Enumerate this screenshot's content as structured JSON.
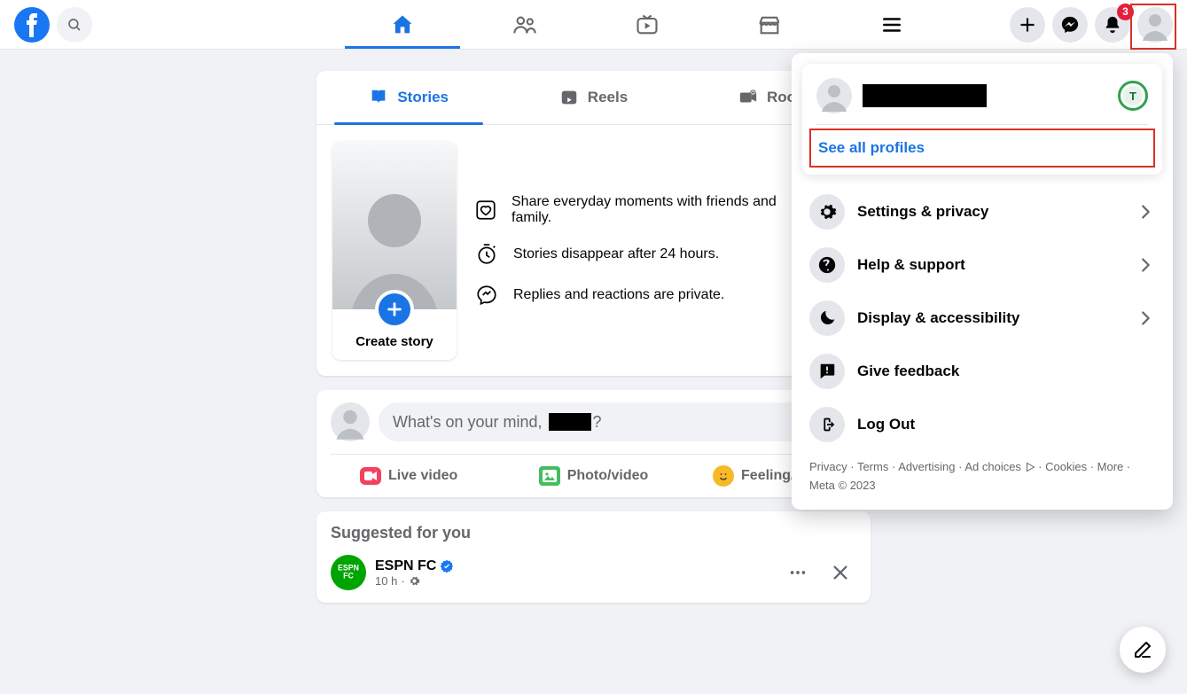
{
  "nav": {
    "notifications_badge": "3"
  },
  "tabs": {
    "stories": "Stories",
    "reels": "Reels",
    "rooms": "Rooms"
  },
  "stories_card": {
    "create_label": "Create story",
    "point1": "Share everyday moments with friends and family.",
    "point2": "Stories disappear after 24 hours.",
    "point3": "Replies and reactions are private."
  },
  "composer": {
    "prompt_prefix": "What's on your mind,",
    "prompt_suffix": "?",
    "live": "Live video",
    "photo": "Photo/video",
    "feeling": "Feeling/activity"
  },
  "suggested": {
    "heading": "Suggested for you",
    "page_name": "ESPN FC",
    "page_avatar_text": "ESPN FC",
    "time": "10 h"
  },
  "account_menu": {
    "switch_letter": "T",
    "see_all": "See all profiles",
    "items": [
      {
        "label": "Settings & privacy",
        "chevron": true
      },
      {
        "label": "Help & support",
        "chevron": true
      },
      {
        "label": "Display & accessibility",
        "chevron": true
      },
      {
        "label": "Give feedback",
        "chevron": false
      },
      {
        "label": "Log Out",
        "chevron": false
      }
    ],
    "footer": {
      "links": [
        "Privacy",
        "Terms",
        "Advertising",
        "Ad choices",
        "Cookies",
        "More"
      ],
      "copyright": "Meta © 2023"
    }
  }
}
